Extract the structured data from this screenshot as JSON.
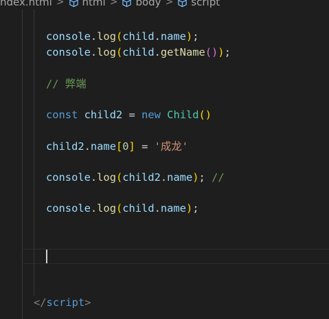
{
  "breadcrumb": {
    "items": [
      {
        "label": "ndex.html",
        "icon": "html-file-icon"
      },
      {
        "label": "html",
        "icon": "cube-icon"
      },
      {
        "label": "body",
        "icon": "cube-icon"
      },
      {
        "label": "script",
        "icon": "cube-icon"
      }
    ],
    "separator": ">"
  },
  "code": {
    "line1": {
      "obj": "console",
      "dot": ".",
      "fn": "log",
      "open": "(",
      "arg_obj": "child",
      "arg_dot": ".",
      "arg_prop": "name",
      "close": ")",
      "end": ";"
    },
    "line2": {
      "obj": "console",
      "dot": ".",
      "fn": "log",
      "open": "(",
      "arg_obj": "child",
      "arg_dot": ".",
      "arg_fn": "getName",
      "inner": "()",
      "close": ")",
      "end": ";"
    },
    "comment": "// 弊端",
    "line4": {
      "kw": "const",
      "var": "child2",
      "eq": "=",
      "kw_new": "new",
      "cls": "Child",
      "parens": "()"
    },
    "line5": {
      "obj": "child2",
      "dot": ".",
      "prop": "name",
      "open": "[",
      "idx": "0",
      "close": "]",
      "eq": "=",
      "str": "'成龙'"
    },
    "line6": {
      "obj": "console",
      "dot": ".",
      "fn": "log",
      "open": "(",
      "arg_obj": "child2",
      "arg_dot": ".",
      "arg_prop": "name",
      "close": ")",
      "end": ";",
      "comment": "//"
    },
    "line7": {
      "obj": "console",
      "dot": ".",
      "fn": "log",
      "open": "(",
      "arg_obj": "child",
      "arg_dot": ".",
      "arg_prop": "name",
      "close": ")",
      "end": ";"
    },
    "closing_tag": {
      "lt": "</",
      "name": "script",
      "gt": ">"
    }
  },
  "colors": {
    "background": "#1e1e1e",
    "keyword": "#569cd6",
    "variable": "#9cdcfe",
    "function": "#dcdcaa",
    "class": "#4ec9b0",
    "string": "#ce9178",
    "comment": "#6a9955",
    "number": "#b5cea8"
  }
}
